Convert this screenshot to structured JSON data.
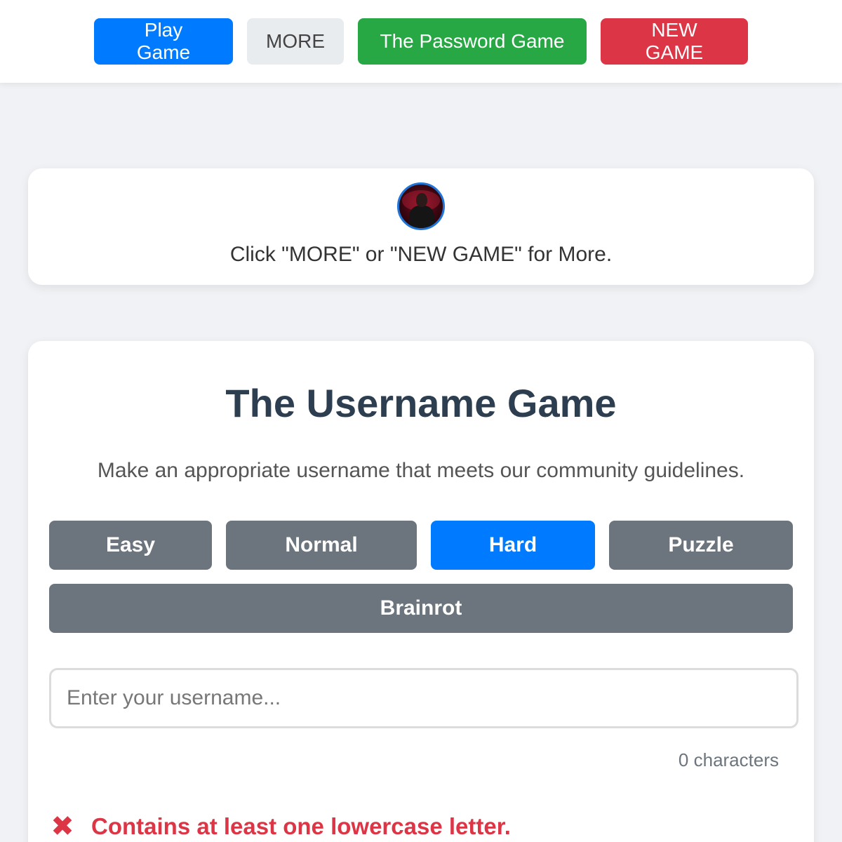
{
  "nav": {
    "play_label": "Play Game",
    "more_label": "MORE",
    "password_label": "The Password Game",
    "new_game_label": "NEW GAME"
  },
  "info": {
    "message": "Click \"MORE\" or \"NEW GAME\" for More."
  },
  "game": {
    "title": "The Username Game",
    "subtitle": "Make an appropriate username that meets our community guidelines.",
    "difficulties": [
      {
        "label": "Easy",
        "active": false
      },
      {
        "label": "Normal",
        "active": false
      },
      {
        "label": "Hard",
        "active": true
      },
      {
        "label": "Puzzle",
        "active": false
      },
      {
        "label": "Brainrot",
        "active": false
      }
    ],
    "input": {
      "value": "",
      "placeholder": "Enter your username..."
    },
    "char_count": "0 characters",
    "rules": [
      {
        "icon": "x-icon",
        "text": "Contains at least one lowercase letter.",
        "status": "failed"
      }
    ]
  },
  "colors": {
    "primary": "#007bff",
    "secondary": "#6c757d",
    "success": "#28a745",
    "danger": "#dc3545",
    "title": "#2c3e50"
  }
}
